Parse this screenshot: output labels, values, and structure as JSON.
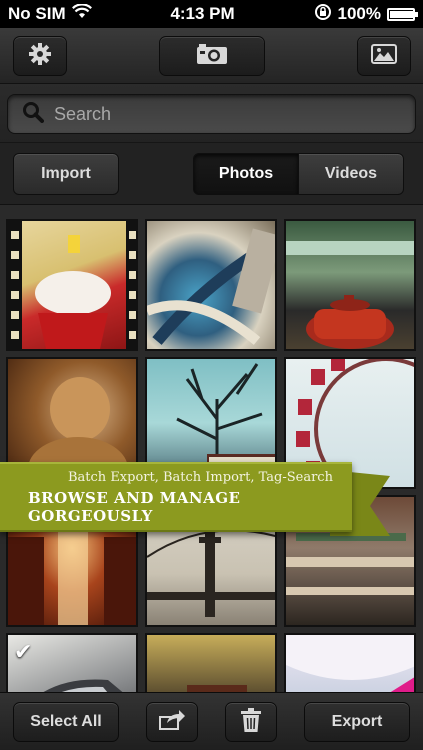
{
  "status_bar": {
    "carrier": "No SIM",
    "time": "4:13 PM",
    "battery": "100%",
    "battery_level": 1.0
  },
  "toolbar": {
    "settings_icon": "gear-icon",
    "camera_icon": "camera-icon",
    "gallery_icon": "photo-icon"
  },
  "search": {
    "placeholder": "Search",
    "value": ""
  },
  "segments": {
    "import_label": "Import",
    "photos_label": "Photos",
    "videos_label": "Videos",
    "selected": "Photos"
  },
  "banner": {
    "subtitle": "Batch Export, Batch Import, Tag-Search",
    "title": "BROWSE AND MANAGE GORGEOUSLY",
    "color": "#8c9a1f"
  },
  "bottom_bar": {
    "select_all_label": "Select All",
    "share_icon": "share-icon",
    "trash_icon": "trash-icon",
    "export_label": "Export"
  },
  "photos": [
    {
      "name": "cupcake-photo",
      "selected": false
    },
    {
      "name": "fisheye-city-photo",
      "selected": false
    },
    {
      "name": "teapot-photo",
      "selected": false
    },
    {
      "name": "buddha-photo",
      "selected": false
    },
    {
      "name": "tree-building-photo",
      "selected": false
    },
    {
      "name": "ferris-wheel-photo",
      "selected": false
    },
    {
      "name": "library-photo",
      "selected": false
    },
    {
      "name": "golden-gate-photo",
      "selected": false
    },
    {
      "name": "mall-photo",
      "selected": false
    },
    {
      "name": "car-photo",
      "selected": true
    },
    {
      "name": "rickshaw-photo",
      "selected": false
    },
    {
      "name": "airplane-interior-photo",
      "selected": false
    }
  ]
}
